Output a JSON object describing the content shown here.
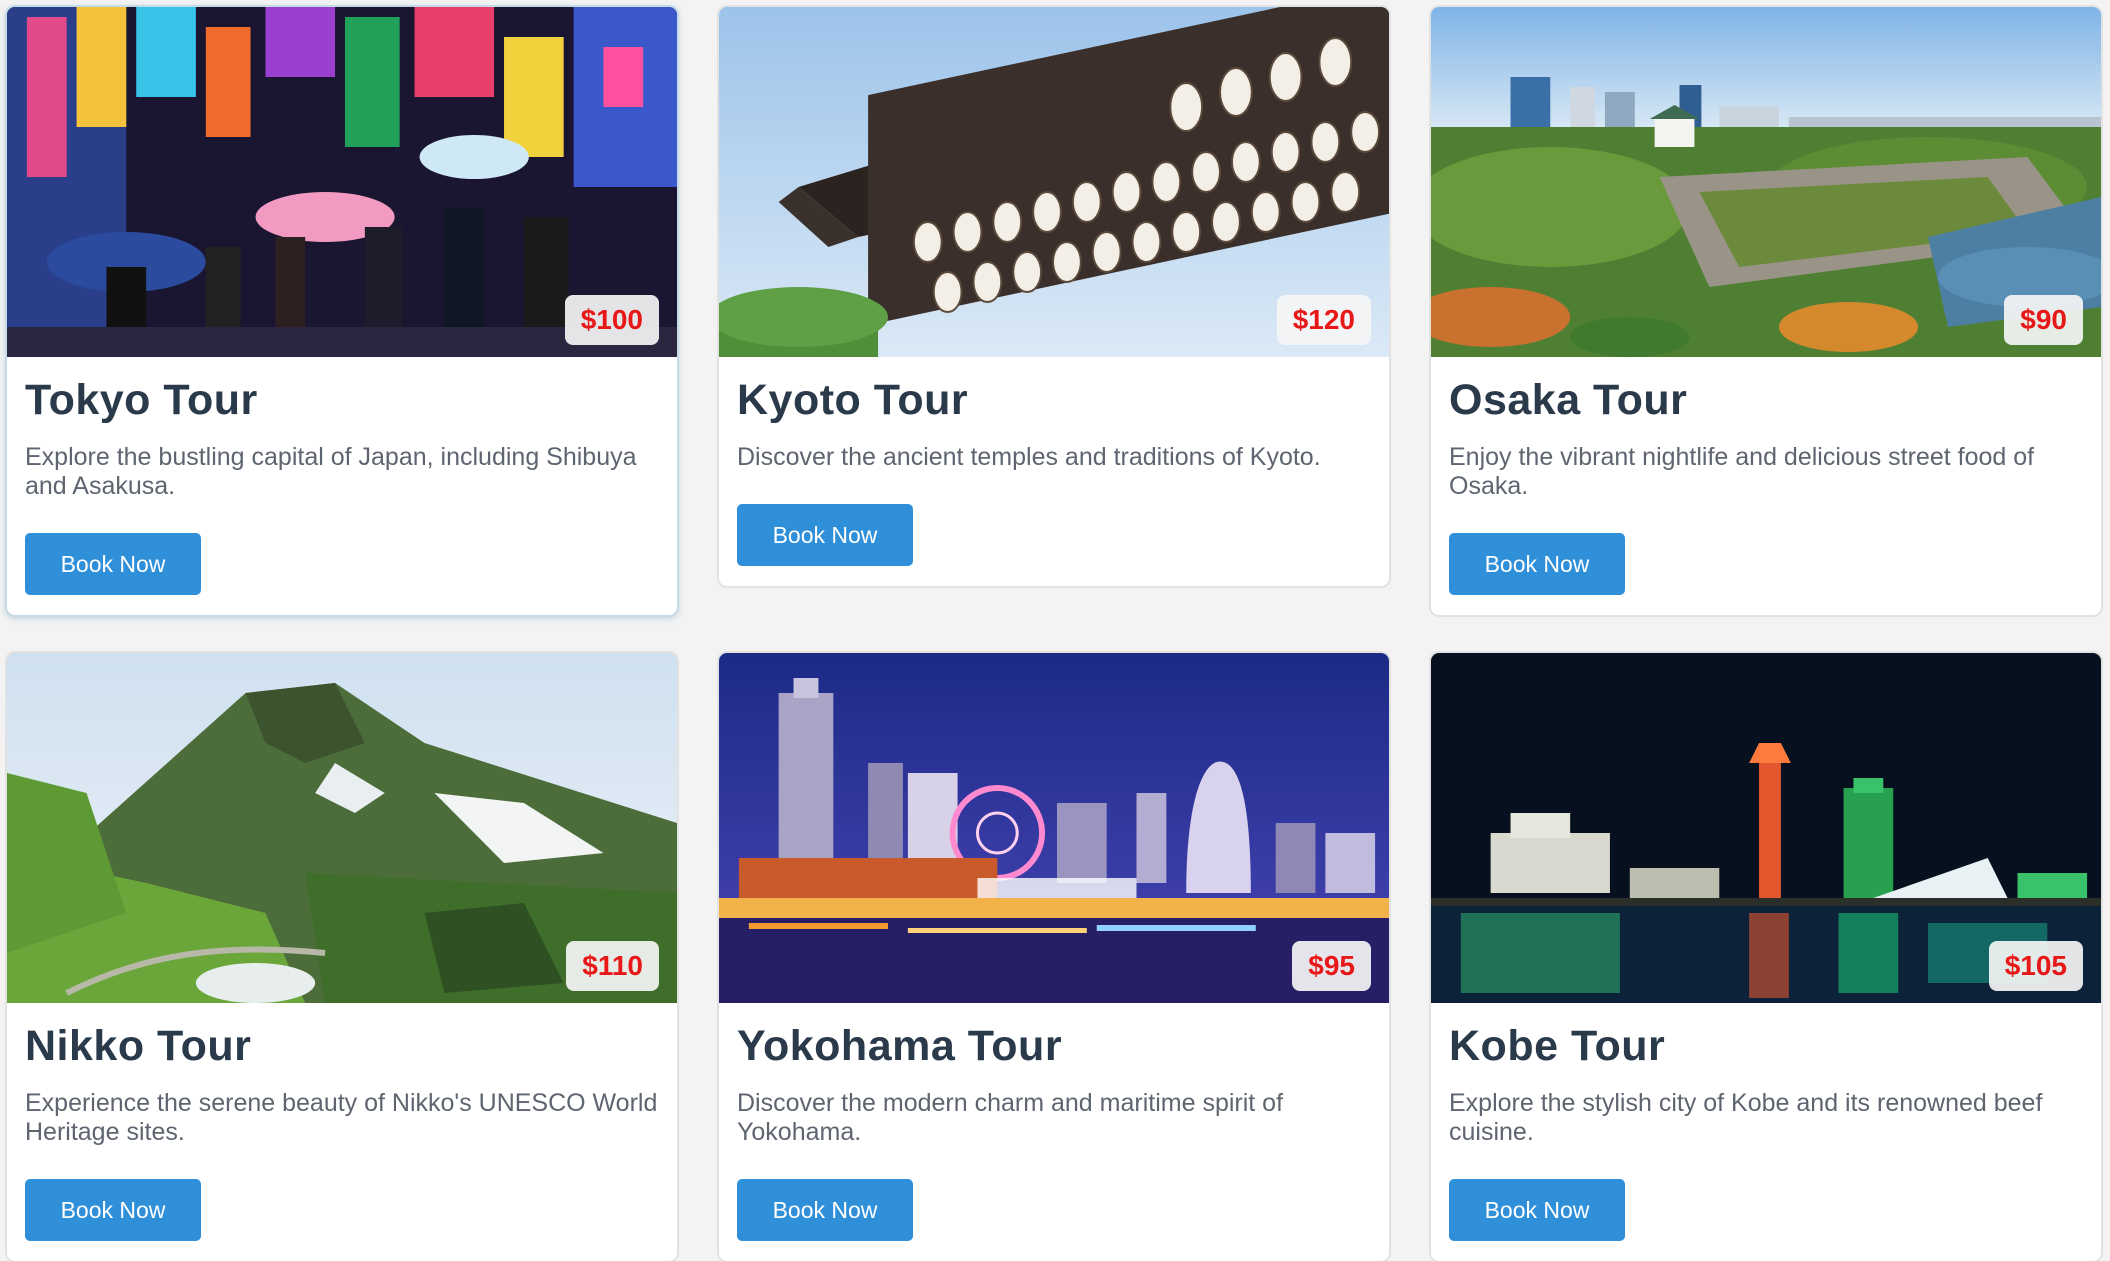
{
  "tours": [
    {
      "title": "Tokyo Tour",
      "description": "Explore the bustling capital of Japan, including Shibuya and Asakusa.",
      "price": "$100",
      "button_label": "Book Now"
    },
    {
      "title": "Kyoto Tour",
      "description": "Discover the ancient temples and traditions of Kyoto.",
      "price": "$120",
      "button_label": "Book Now"
    },
    {
      "title": "Osaka Tour",
      "description": "Enjoy the vibrant nightlife and delicious street food of Osaka.",
      "price": "$90",
      "button_label": "Book Now"
    },
    {
      "title": "Nikko Tour",
      "description": "Experience the serene beauty of Nikko's UNESCO World Heritage sites.",
      "price": "$110",
      "button_label": "Book Now"
    },
    {
      "title": "Yokohama Tour",
      "description": "Discover the modern charm and maritime spirit of Yokohama.",
      "price": "$95",
      "button_label": "Book Now"
    },
    {
      "title": "Kobe Tour",
      "description": "Explore the stylish city of Kobe and its renowned beef cuisine.",
      "price": "$105",
      "button_label": "Book Now"
    }
  ],
  "colors": {
    "price_text": "#e81818",
    "button_bg": "#2f8fd9",
    "title_text": "#2a3a4b"
  }
}
